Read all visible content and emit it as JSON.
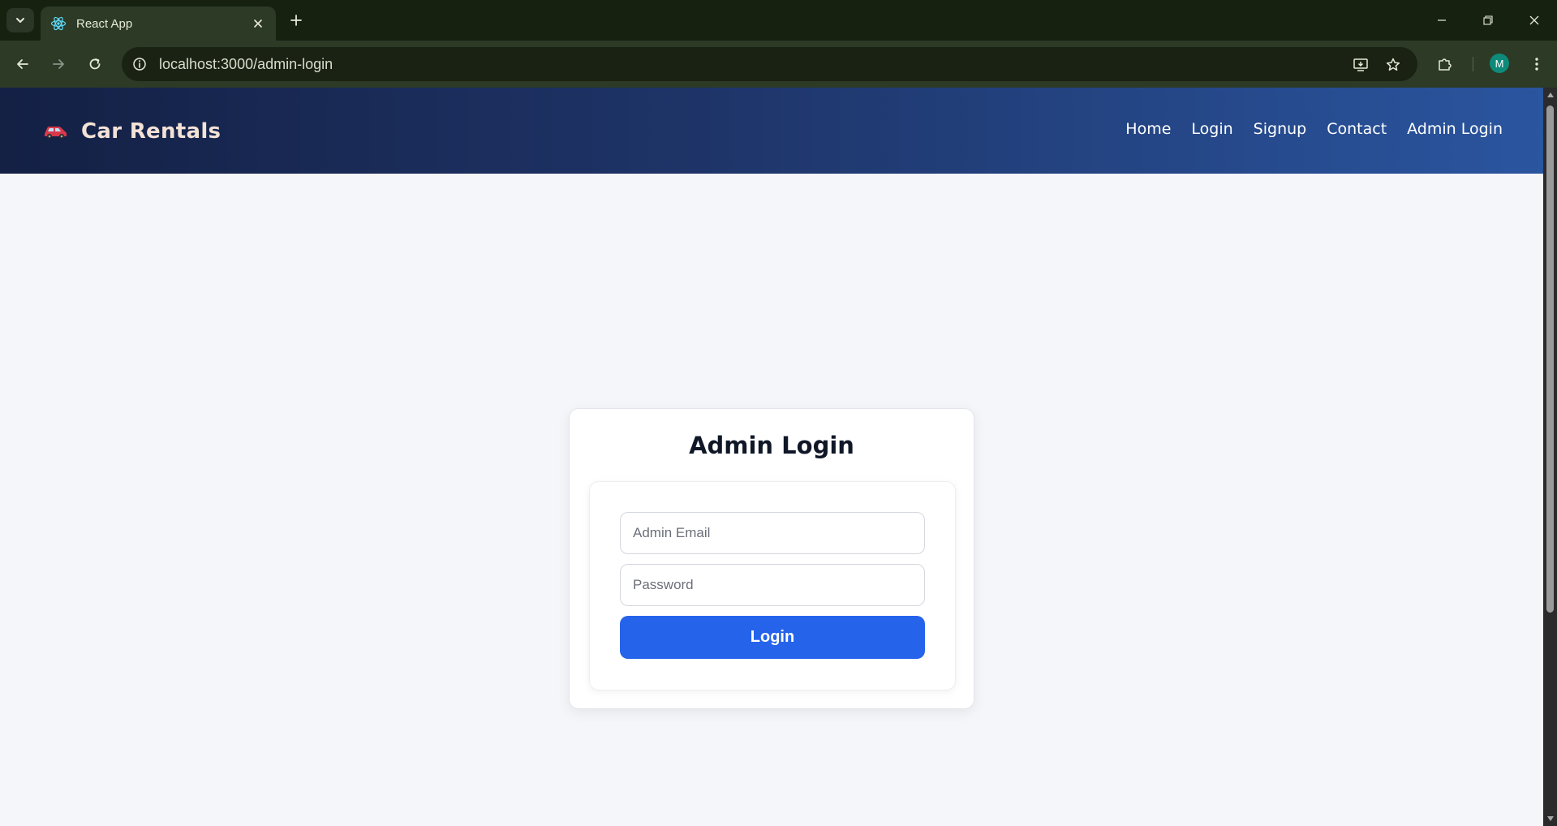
{
  "browser": {
    "tab_title": "React App",
    "url": "localhost:3000/admin-login",
    "profile_initial": "M"
  },
  "icons": {
    "tab_list": "chevron-down-icon",
    "favicon": "react-icon",
    "tab_close": "close-icon",
    "new_tab": "plus-icon",
    "back": "arrow-left-icon",
    "forward": "arrow-right-icon",
    "reload": "reload-icon",
    "site_info": "info-icon",
    "install": "install-icon",
    "bookmark": "star-icon",
    "extensions": "puzzle-icon",
    "menu": "kebab-icon",
    "brand": "car-icon"
  },
  "colors": {
    "header_gradient_start": "#142044",
    "header_gradient_end": "#2a559f",
    "button_primary": "#2563eb",
    "page_background": "#f5f6fa",
    "brand_text": "#f3e2d6"
  },
  "header": {
    "brand": "Car Rentals",
    "nav": [
      {
        "label": "Home"
      },
      {
        "label": "Login"
      },
      {
        "label": "Signup"
      },
      {
        "label": "Contact"
      },
      {
        "label": "Admin Login"
      }
    ]
  },
  "login": {
    "title": "Admin Login",
    "email_placeholder": "Admin Email",
    "email_value": "",
    "password_placeholder": "Password",
    "password_value": "",
    "submit_label": "Login"
  }
}
